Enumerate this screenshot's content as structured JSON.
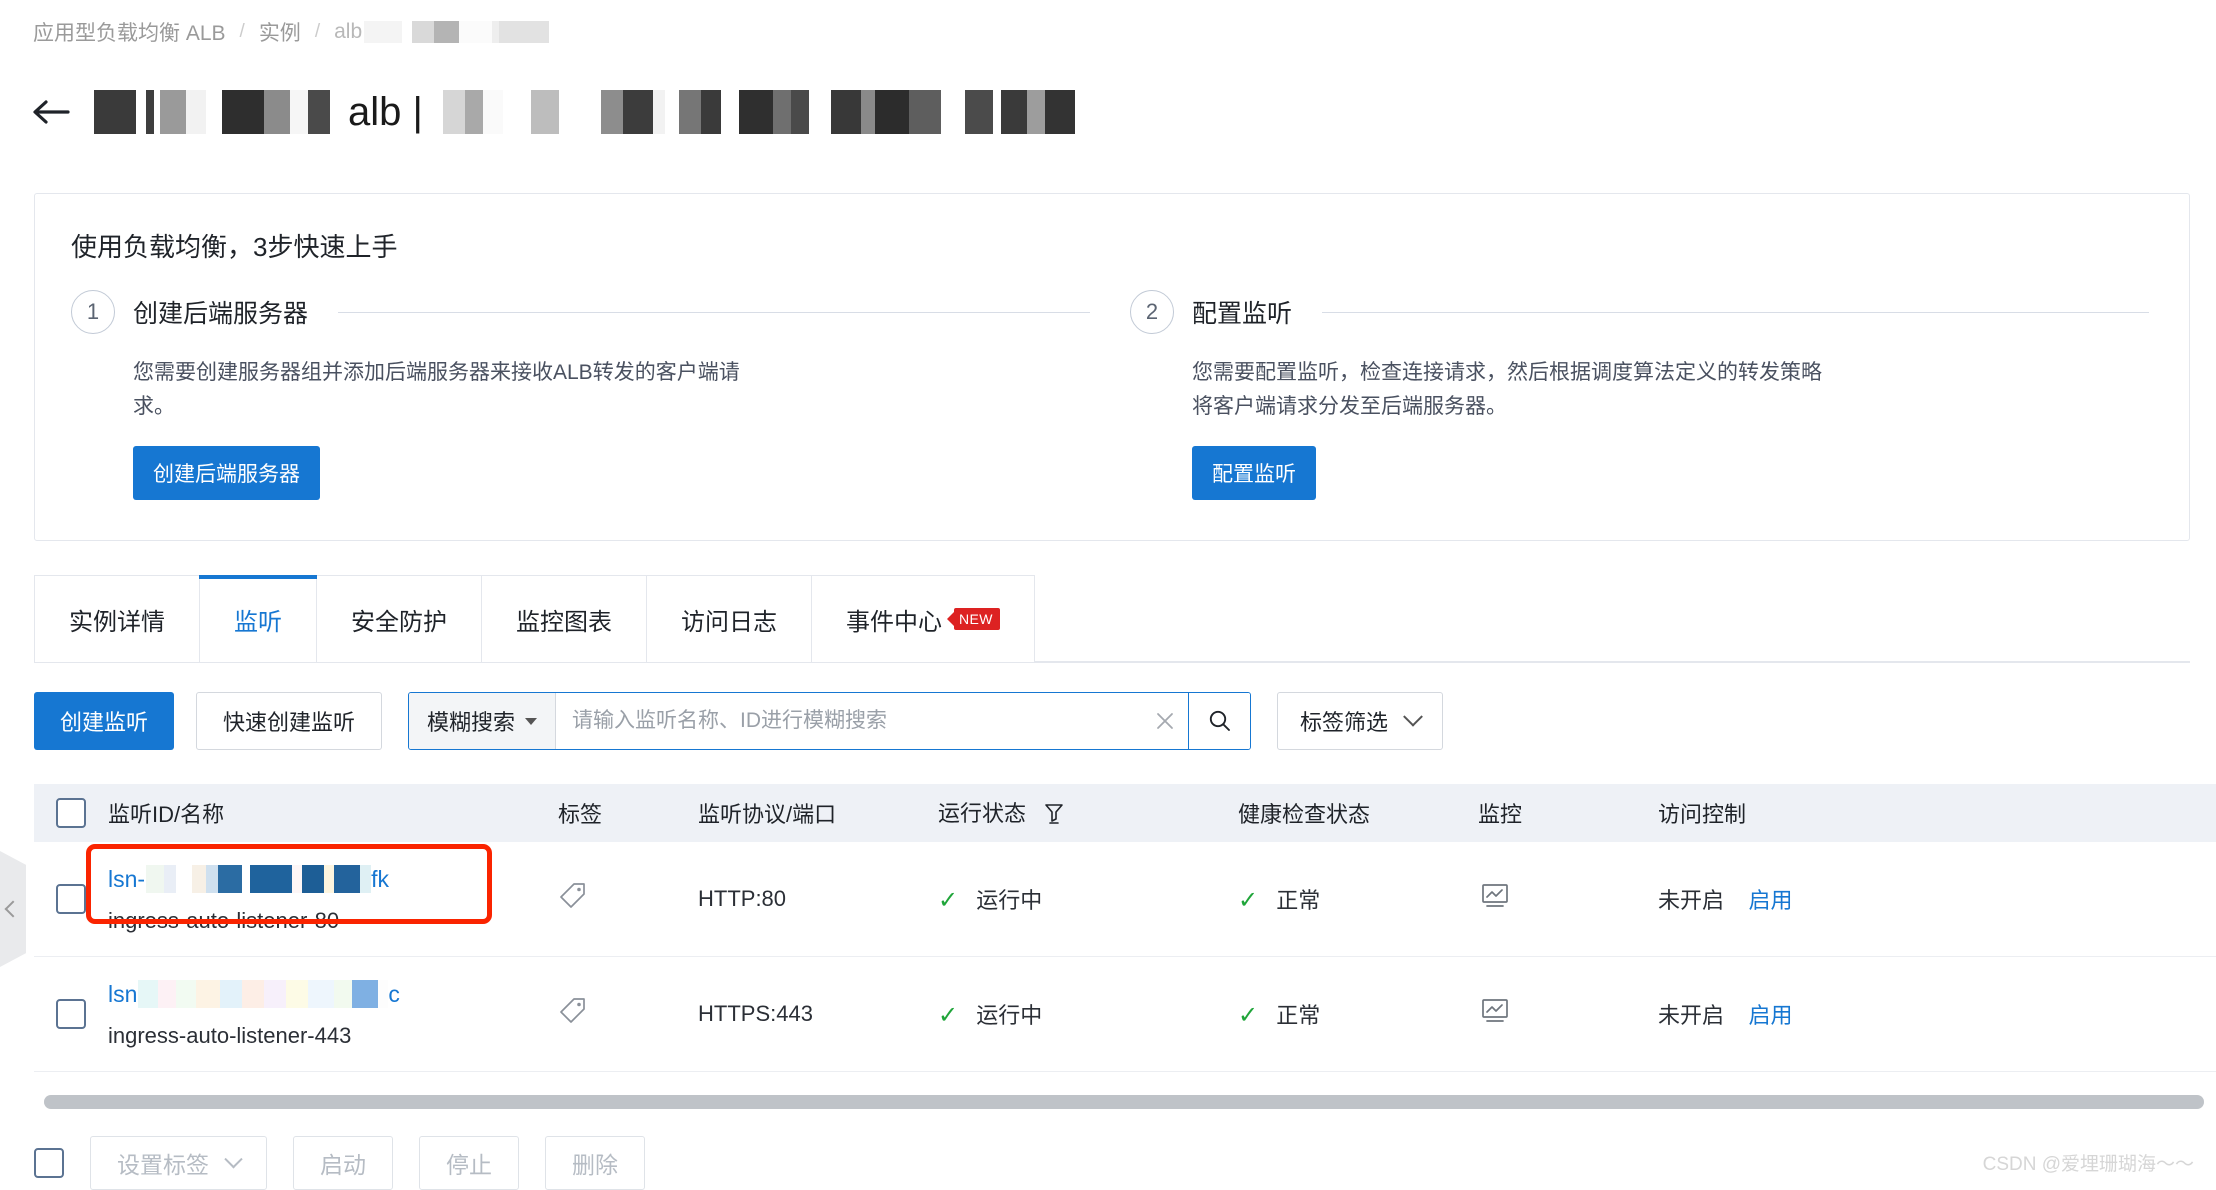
{
  "breadcrumb": {
    "product": "应用型负载均衡 ALB",
    "sep": "/",
    "section": "实例",
    "current": "alb",
    "redacted": true
  },
  "header": {
    "back_icon": "arrow-left-icon",
    "title_visible_text": "alb |",
    "title_redacted": true
  },
  "guide": {
    "title": "使用负载均衡，3步快速上手",
    "steps": [
      {
        "number": "1",
        "name": "创建后端服务器",
        "description": "您需要创建服务器组并添加后端服务器来接收ALB转发的客户端请求。",
        "button": "创建后端服务器"
      },
      {
        "number": "2",
        "name": "配置监听",
        "description": "您需要配置监听，检查连接请求，然后根据调度算法定义的转发策略将客户端请求分发至后端服务器。",
        "button": "配置监听"
      }
    ]
  },
  "tabs": [
    {
      "label": "实例详情",
      "active": false,
      "badge": ""
    },
    {
      "label": "监听",
      "active": true,
      "badge": ""
    },
    {
      "label": "安全防护",
      "active": false,
      "badge": ""
    },
    {
      "label": "监控图表",
      "active": false,
      "badge": ""
    },
    {
      "label": "访问日志",
      "active": false,
      "badge": ""
    },
    {
      "label": "事件中心",
      "active": false,
      "badge": "NEW"
    }
  ],
  "toolbar": {
    "create_label": "创建监听",
    "quick_create_label": "快速创建监听",
    "search_mode": "模糊搜索",
    "search_placeholder": "请输入监听名称、ID进行模糊搜索",
    "search_value": "",
    "clear_icon": "close-icon",
    "search_icon": "search-icon",
    "tag_filter_label": "标签筛选"
  },
  "table": {
    "columns": [
      "监听ID/名称",
      "标签",
      "监听协议/端口",
      "运行状态",
      "健康检查状态",
      "监控",
      "访问控制"
    ],
    "state_filter_icon": "filter-icon",
    "rows": [
      {
        "id_prefix": "lsn-",
        "id_suffix": "fk",
        "id_redacted": true,
        "name": "ingress-auto-listener-80",
        "tag_icon": "tag-icon",
        "protocol_port": "HTTP:80",
        "run_state": "运行中",
        "run_state_icon": "check-icon",
        "health_state": "正常",
        "health_state_icon": "check-icon",
        "monitor_icon": "monitor-chart-icon",
        "acl_status": "未开启",
        "acl_action": "启用",
        "highlighted": true
      },
      {
        "id_prefix": "lsn",
        "id_suffix": "c",
        "id_redacted": true,
        "name": "ingress-auto-listener-443",
        "tag_icon": "tag-icon",
        "protocol_port": "HTTPS:443",
        "run_state": "运行中",
        "run_state_icon": "check-icon",
        "health_state": "正常",
        "health_state_icon": "check-icon",
        "monitor_icon": "monitor-chart-icon",
        "acl_status": "未开启",
        "acl_action": "启用",
        "highlighted": false
      }
    ]
  },
  "bottom_bar": {
    "set_tag_label": "设置标签",
    "start_label": "启动",
    "stop_label": "停止",
    "delete_label": "删除"
  },
  "watermark": "CSDN @爱埋珊瑚海～～",
  "colors": {
    "primary": "#1677d2",
    "success": "#20a53a",
    "highlight": "#fa2400",
    "badge_red": "#dd2222",
    "header_bg": "#eef1f6"
  }
}
